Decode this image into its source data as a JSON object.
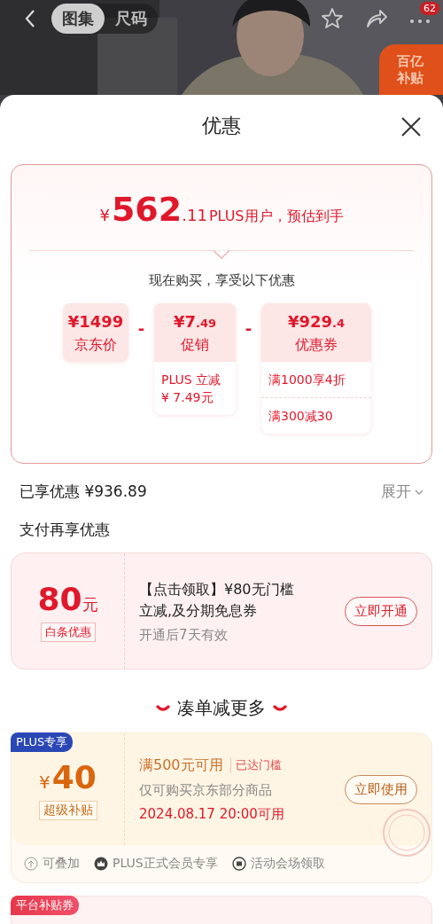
{
  "top_bar": {
    "tabs": [
      {
        "label": "图集",
        "selected": true
      },
      {
        "label": "尺码",
        "selected": false
      }
    ],
    "more_badge": "62",
    "promo_badge": "百亿补贴"
  },
  "sheet": {
    "title": "优惠"
  },
  "estimate": {
    "currency": "¥",
    "price_int": "562",
    "price_dec": ".11",
    "caption": "PLUS用户，预估到手",
    "subtitle": "现在购买，享受以下优惠",
    "terms": [
      {
        "amount": "¥1499",
        "label": "京东价"
      },
      {
        "operator": "-",
        "amount": "¥7",
        "decimals": ".49",
        "label": "促销",
        "details": [
          "PLUS 立减\n¥ 7.49元"
        ]
      },
      {
        "operator": "-",
        "amount": "¥929",
        "decimals": ".4",
        "label": "优惠券",
        "details": [
          "满1000享4折",
          "满300减30"
        ]
      }
    ]
  },
  "savings": {
    "label": "已享优惠 ¥936.89",
    "toggle": "展开"
  },
  "pay_section": {
    "title": "支付再享优惠",
    "offer": {
      "amount": "80",
      "unit": "元",
      "tag": "白条优惠",
      "title": "【点击领取】¥80无门槛立减,及分期免息券",
      "note": "开通后7天有效",
      "button": "立即开通"
    }
  },
  "more_section": {
    "title": "凑单减更多",
    "coupons": [
      {
        "kind": "plus",
        "badge": "PLUS专享",
        "currency": "¥",
        "amount": "40",
        "tag": "超级补贴",
        "condition": "满500元可用",
        "status": "已达门槛",
        "scope": "仅可购买京东部分商品",
        "time": "2024.08.17 20:00可用",
        "button": "立即使用",
        "features": [
          "可叠加",
          "PLUS正式会员专享",
          "活动会场领取"
        ]
      },
      {
        "kind": "platform",
        "badge": "平台补贴券"
      }
    ]
  }
}
